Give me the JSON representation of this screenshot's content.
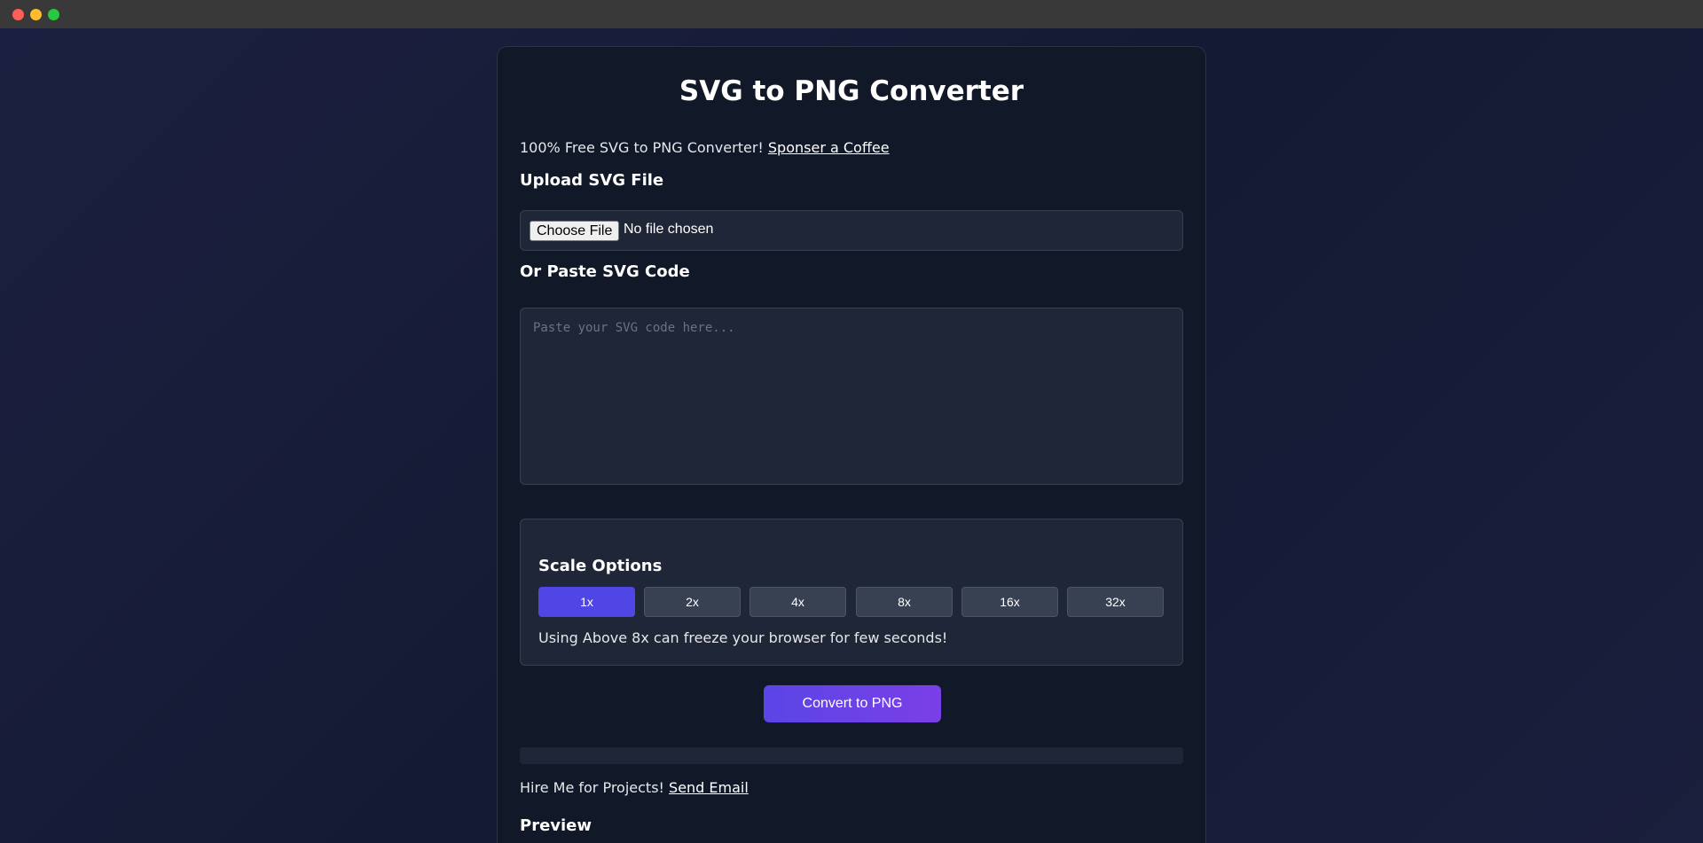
{
  "window": {
    "controls": [
      "close",
      "minimize",
      "maximize"
    ]
  },
  "colors": {
    "accent": "#4f46e5",
    "card_bg": "#111827",
    "panel_bg": "#1f2637"
  },
  "header": {
    "title": "SVG to PNG Converter"
  },
  "promo": {
    "text": "100% Free SVG to PNG Converter! ",
    "link": "Sponser a Coffee"
  },
  "upload": {
    "label": "Upload SVG File",
    "button_label": "Choose File",
    "status": "No file chosen"
  },
  "paste": {
    "label": "Or Paste SVG Code",
    "value": "",
    "placeholder": "Paste your SVG code here..."
  },
  "scale": {
    "title": "Scale Options",
    "options": [
      "1x",
      "2x",
      "4x",
      "8x",
      "16x",
      "32x"
    ],
    "selected": "1x",
    "note": "Using Above 8x can freeze your browser for few seconds!"
  },
  "actions": {
    "convert_label": "Convert to PNG"
  },
  "progress": {
    "value": 0
  },
  "hire": {
    "text": "Hire Me for Projects! ",
    "link": "Send Email"
  },
  "preview": {
    "label": "Preview"
  }
}
